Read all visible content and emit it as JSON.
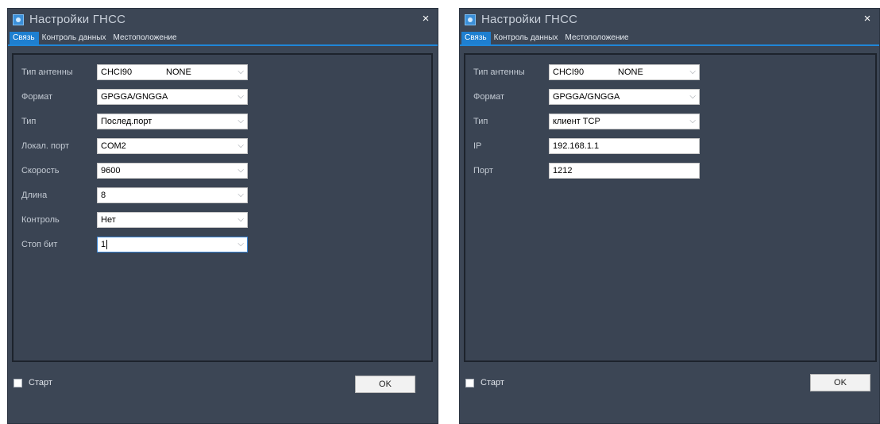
{
  "windows": [
    {
      "title": "Настройки ГНСС",
      "close": "×",
      "tabs": [
        "Связь",
        "Контроль данных",
        "Местоположение"
      ],
      "fields": [
        {
          "label": "Тип антенны",
          "value": "CHCI90",
          "value2": "NONE"
        },
        {
          "label": "Формат",
          "value": "GPGGA/GNGGA"
        },
        {
          "label": "Тип",
          "value": "Послед.порт"
        },
        {
          "label": "Локал. порт",
          "value": "COM2"
        },
        {
          "label": "Скорость",
          "value": "9600"
        },
        {
          "label": "Длина",
          "value": "8"
        },
        {
          "label": "Контроль",
          "value": "Нет"
        },
        {
          "label": "Стоп бит",
          "value": "1"
        }
      ],
      "start_label": "Старт",
      "ok_label": "OK"
    },
    {
      "title": "Настройки ГНСС",
      "close": "×",
      "tabs": [
        "Связь",
        "Контроль данных",
        "Местоположение"
      ],
      "fields": [
        {
          "label": "Тип антенны",
          "value": "CHCI90",
          "value2": "NONE"
        },
        {
          "label": "Формат",
          "value": "GPGGA/GNGGA"
        },
        {
          "label": "Тип",
          "value": "клиент TCP"
        },
        {
          "label": "IP",
          "value": "192.168.1.1"
        },
        {
          "label": "Порт",
          "value": "1212"
        }
      ],
      "start_label": "Старт",
      "ok_label": "OK"
    }
  ],
  "colors": {
    "window_bg": "#3c4655",
    "tab_active": "#1e7fd0",
    "panel_bg": "#3a4453"
  },
  "icons": {
    "app": "gnss-settings-icon",
    "close": "close-icon",
    "dropdown": "chevron-down-icon"
  }
}
